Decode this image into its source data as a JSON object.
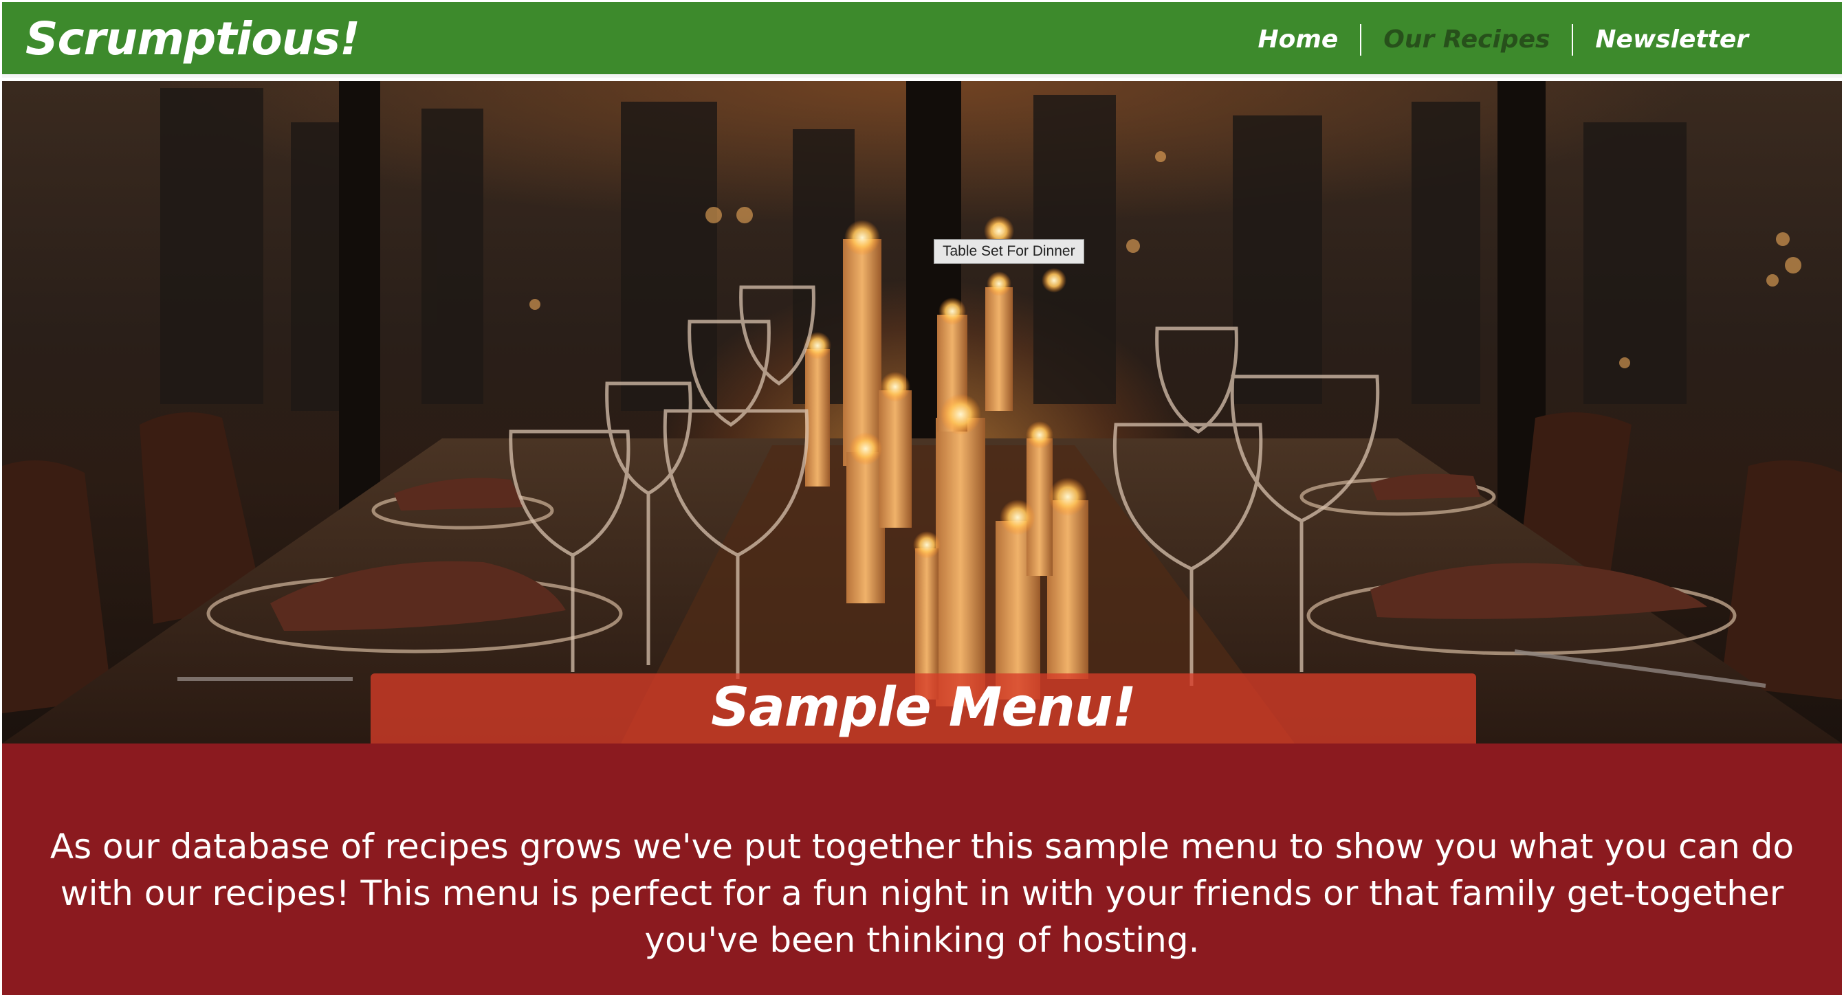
{
  "header": {
    "logo": "Scrumptious!",
    "nav": [
      {
        "label": "Home",
        "active": false
      },
      {
        "label": "Our Recipes",
        "active": true
      },
      {
        "label": "Newsletter",
        "active": false
      }
    ]
  },
  "hero": {
    "image_tooltip": "Table Set For Dinner",
    "title": "Sample Menu!"
  },
  "intro": {
    "text": "As our database of recipes grows we've put together this sample menu to show you what you can do with our recipes! This menu is perfect for a fun night in with your friends or that family get-together you've been thinking of hosting."
  },
  "colors": {
    "header_green": "#3d8a2c",
    "active_link": "#27501b",
    "banner_red": "#d63c28",
    "intro_red": "#8b1a1f"
  }
}
